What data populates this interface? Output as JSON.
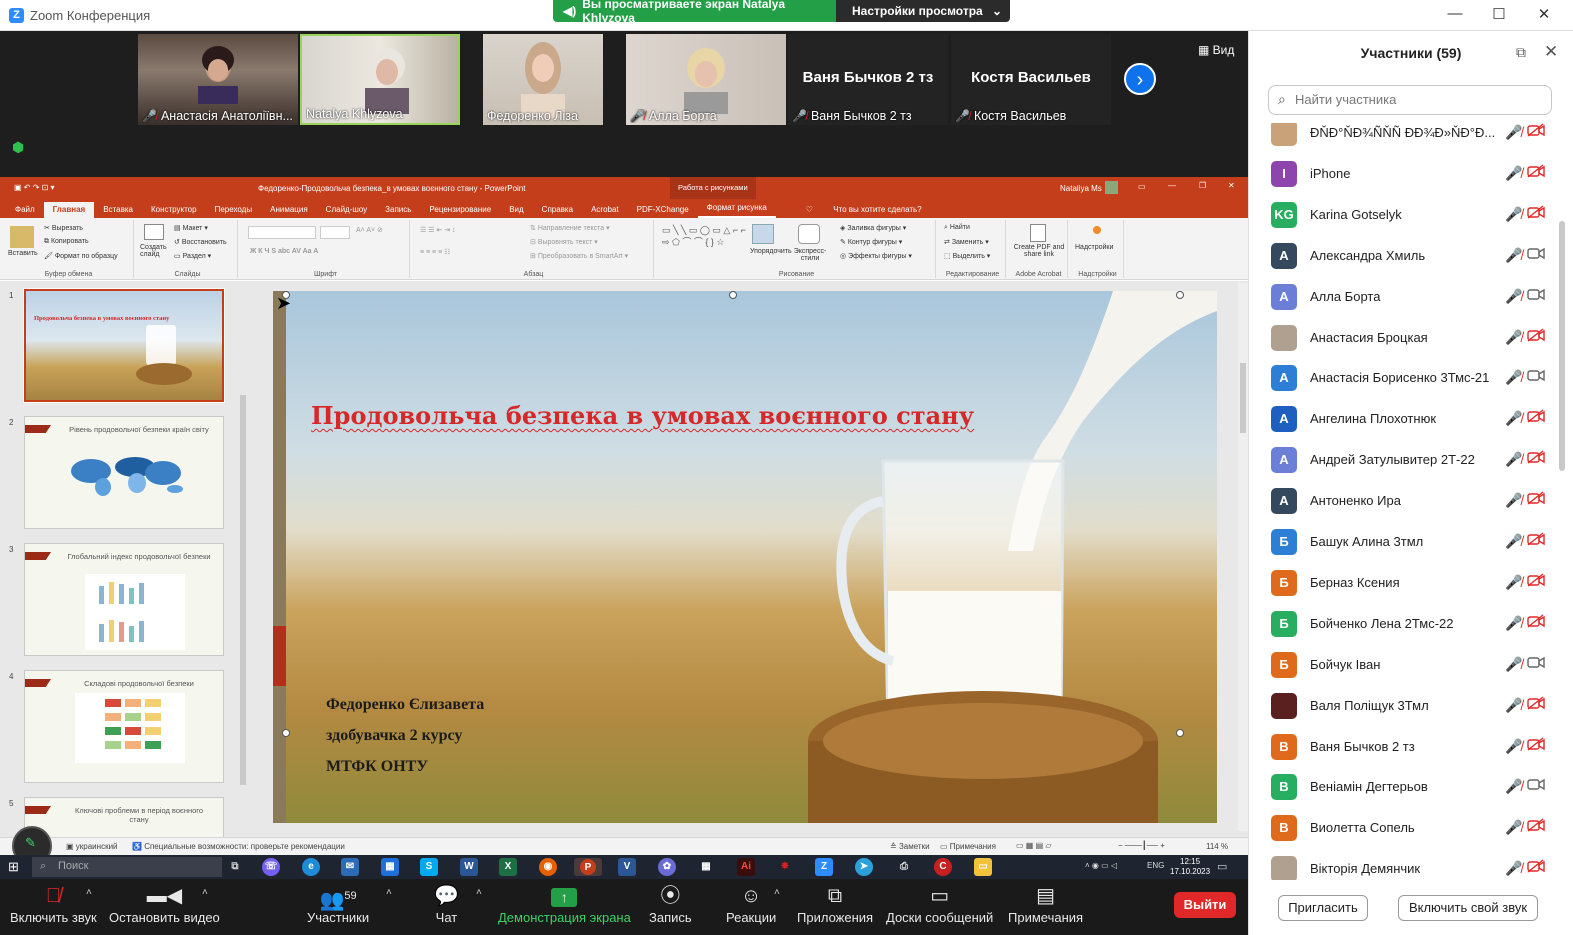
{
  "window": {
    "title": "Zoom Конференция"
  },
  "share_banner": {
    "viewing": "Вы просматриваете экран Natalya Khlyzova",
    "settings": "Настройки просмотра"
  },
  "video": {
    "tiles": [
      {
        "name": "Анастасія Анатоліївн...",
        "muted": true
      },
      {
        "name": "Natalya Khlyzova",
        "muted": false
      },
      {
        "name": "Федоренко Ліза",
        "muted": false
      },
      {
        "name": "Алла Борта",
        "muted": true
      },
      {
        "name": "Ваня Бычков 2 тз",
        "label": "Ваня Бычков 2 тз",
        "muted": true
      },
      {
        "name": "Костя Васильев",
        "label": "Костя Васильев",
        "muted": true
      }
    ],
    "view_label": "Вид"
  },
  "powerpoint": {
    "doc_title": "Федоренко-Продовольча безпека_в умовах воєнного стану - PowerPoint",
    "context_tab": "Работа с рисунками",
    "user": "Nataliya Ms",
    "tabs": [
      "Файл",
      "Главная",
      "Вставка",
      "Конструктор",
      "Переходы",
      "Анимация",
      "Слайд-шоу",
      "Запись",
      "Рецензирование",
      "Вид",
      "Справка",
      "Acrobat",
      "PDF-XChange",
      "Формат рисунка"
    ],
    "tell_me": "Что вы хотите сделать?",
    "ribbon": {
      "paste": "Вставить",
      "cut": "Вырезать",
      "copy": "Копировать",
      "format_painter": "Формат по образцу",
      "clipboard": "Буфер обмена",
      "new_slide": "Создать слайд",
      "layout": "Макет",
      "reset": "Восстановить",
      "section": "Раздел",
      "slides": "Слайды",
      "font": "Шрифт",
      "text_direction": "Направление текста",
      "align_text": "Выровнять текст",
      "smartart": "Преобразовать в SmartArt",
      "paragraph": "Абзац",
      "arrange": "Упорядочить",
      "quick_styles": "Экспресс-стили",
      "fill": "Заливка фигуры",
      "outline": "Контур фигуры",
      "effects": "Эффекты фигуры",
      "drawing": "Рисование",
      "find": "Найти",
      "replace": "Заменить",
      "select": "Выделить",
      "editing": "Редактирование",
      "create_pdf": "Create PDF and share link",
      "adobe": "Adobe Acrobat",
      "addins": "Надстройки",
      "addins_group": "Надстройки"
    },
    "thumbnails": [
      {
        "num": "1",
        "title": "Продовольча безпека в умовах воєнного стану"
      },
      {
        "num": "2",
        "title": "Рівень продовольчої безпеки країн світу"
      },
      {
        "num": "3",
        "title": "Глобальний індекс продовольчої безпеки"
      },
      {
        "num": "4",
        "title": "Складові продовольчої безпеки"
      },
      {
        "num": "5",
        "title": "Ключові проблеми в період воєнного стану"
      }
    ],
    "slide": {
      "title": "Продовольча безпека в умовах воєнного стану",
      "author": "Федоренко Єлизавета",
      "course": "здобувачка 2 курсу",
      "org": "МТФК ОНТУ"
    },
    "status": {
      "lang": "украинский",
      "accessibility": "Специальные возможности: проверьте рекомендации",
      "notes": "Заметки",
      "comments": "Примечания",
      "zoom": "114 %"
    }
  },
  "taskbar": {
    "search": "Поиск",
    "lang": "ENG",
    "time": "12:15",
    "date": "17.10.2023"
  },
  "toolbar": {
    "unmute": "Включить звук",
    "stop_video": "Остановить видео",
    "participants": "Участники",
    "participants_count": "59",
    "chat": "Чат",
    "share": "Демонстрация экрана",
    "record": "Запись",
    "reactions": "Реакции",
    "apps": "Приложения",
    "boards": "Доски сообщений",
    "notes": "Примечания",
    "leave": "Выйти"
  },
  "panel": {
    "title": "Участники (59)",
    "search_placeholder": "Найти участника",
    "participants": [
      {
        "name": "ĐŇĐ°ŇĐ¾ÑŇÑ ĐĐ¾Đ»ŇĐ°Đ...",
        "initial": "",
        "color": "#c9a27a",
        "photo": true,
        "cam_on": false
      },
      {
        "name": "iPhone",
        "initial": "I",
        "color": "#8e44ad",
        "cam_on": false
      },
      {
        "name": "Karina Gotselyk",
        "initial": "KG",
        "color": "#27ae60",
        "cam_on": false
      },
      {
        "name": "Александра Хмиль",
        "initial": "А",
        "color": "#34495e",
        "cam_on": true
      },
      {
        "name": "Алла Борта",
        "initial": "А",
        "color": "#6c7fd6",
        "cam_on": true
      },
      {
        "name": "Анастасия Броцкая",
        "initial": "",
        "color": "#b0a090",
        "photo": true,
        "cam_on": false
      },
      {
        "name": "Анастасія Борисенко 3Тмс-21",
        "initial": "А",
        "color": "#2d7fd6",
        "cam_on": true
      },
      {
        "name": "Ангелина  Плохотнюк",
        "initial": "А",
        "color": "#1f5fbf",
        "cam_on": false
      },
      {
        "name": "Андрей Затулывитер 2Т-22",
        "initial": "А",
        "color": "#6c7fd6",
        "cam_on": false
      },
      {
        "name": "Антоненко Ира",
        "initial": "А",
        "color": "#34495e",
        "cam_on": false
      },
      {
        "name": "Башук Алина 3тмл",
        "initial": "Б",
        "color": "#2d7fd6",
        "cam_on": false
      },
      {
        "name": "Берназ Ксения",
        "initial": "Б",
        "color": "#e06a1b",
        "cam_on": false
      },
      {
        "name": "Бойченко Лена 2Тмс-22",
        "initial": "Б",
        "color": "#27ae60",
        "cam_on": false
      },
      {
        "name": "Бойчук Іван",
        "initial": "Б",
        "color": "#e06a1b",
        "cam_on": true
      },
      {
        "name": "Валя Поліщук 3Тмл",
        "initial": "",
        "color": "#5a2020",
        "photo": true,
        "cam_on": false
      },
      {
        "name": "Ваня Бычков 2 тз",
        "initial": "В",
        "color": "#e06a1b",
        "cam_on": false
      },
      {
        "name": "Веніамін Дегтерьов",
        "initial": "В",
        "color": "#27ae60",
        "cam_on": true
      },
      {
        "name": "Виолетта  Сопель",
        "initial": "В",
        "color": "#e06a1b",
        "cam_on": false
      },
      {
        "name": "Вікторія Демянчик",
        "initial": "",
        "color": "#b0a090",
        "photo": true,
        "cam_on": false
      }
    ],
    "invite": "Пригласить",
    "unmute_me": "Включить свой звук"
  }
}
